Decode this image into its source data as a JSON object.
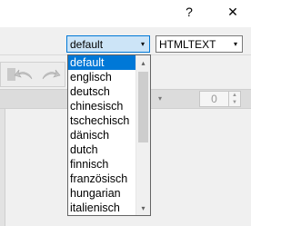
{
  "window": {
    "help_label": "?",
    "close_label": "✕"
  },
  "toolbar": {
    "language_combo": {
      "value": "default"
    },
    "format_combo": {
      "value": "HTMLTEXT"
    },
    "spin_value": "0"
  },
  "icons": {
    "dropdown_arrow": "▾",
    "scroll_up": "▴",
    "scroll_down": "▾",
    "spin_up": "▲",
    "spin_down": "▼"
  },
  "dropdown": {
    "items": [
      "default",
      "englisch",
      "deutsch",
      "chinesisch",
      "tschechisch",
      "dänisch",
      "dutch",
      "finnisch",
      "französisch",
      "hungarian",
      "italienisch"
    ],
    "selected_index": 0
  },
  "colors": {
    "selection": "#0078d7",
    "frame": "#f0f0f0"
  }
}
